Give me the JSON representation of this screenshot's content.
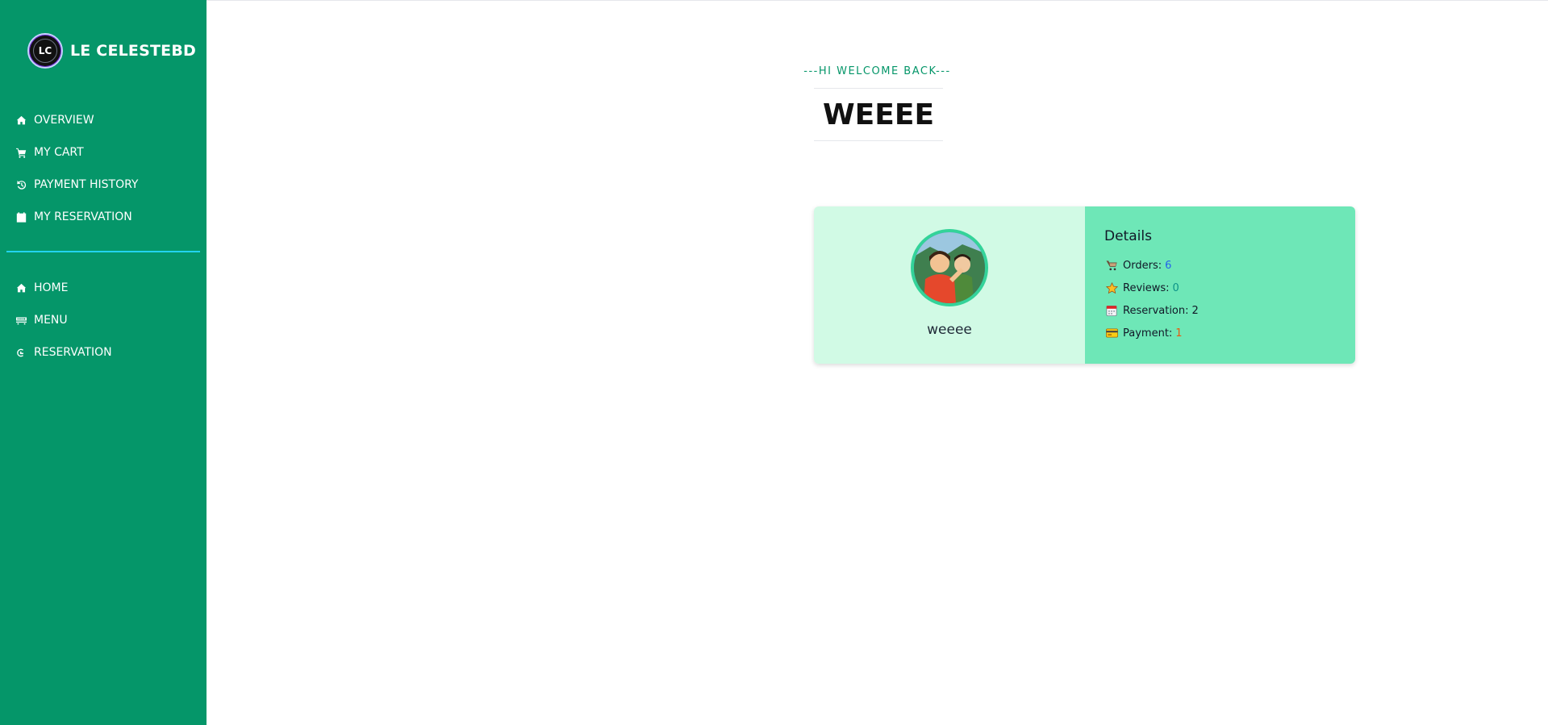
{
  "brand": {
    "logo_text": "LC",
    "name": "LE CELESTEBD"
  },
  "sidebar": {
    "top_items": [
      {
        "label": "OVERVIEW",
        "icon": "home-icon"
      },
      {
        "label": "MY CART",
        "icon": "cart-icon"
      },
      {
        "label": "PAYMENT HISTORY",
        "icon": "history-icon"
      },
      {
        "label": "MY RESERVATION",
        "icon": "calendar-check-icon"
      }
    ],
    "bottom_items": [
      {
        "label": "HOME",
        "icon": "home-icon"
      },
      {
        "label": "MENU",
        "icon": "menu-icon"
      },
      {
        "label": "RESERVATION",
        "icon": "reservation-icon"
      }
    ],
    "divider_color": "#22d3ee",
    "background": "#059669"
  },
  "header": {
    "subtitle": "---HI WELCOME BACK---",
    "title": "WEEEE"
  },
  "profile": {
    "username": "weeee",
    "avatar": "user-avatar-illustration"
  },
  "details": {
    "title": "Details",
    "stats": [
      {
        "label": "Orders:",
        "value": "6",
        "color": "#2563eb",
        "icon": "cart-emoji-icon"
      },
      {
        "label": "Reviews:",
        "value": "0",
        "color": "#0d9488",
        "icon": "star-emoji-icon"
      },
      {
        "label": "Reservation:",
        "value": "2",
        "color": "#111827",
        "icon": "calendar-emoji-icon"
      },
      {
        "label": "Payment:",
        "value": "1",
        "color": "#ea580c",
        "icon": "credit-card-emoji-icon"
      }
    ]
  }
}
